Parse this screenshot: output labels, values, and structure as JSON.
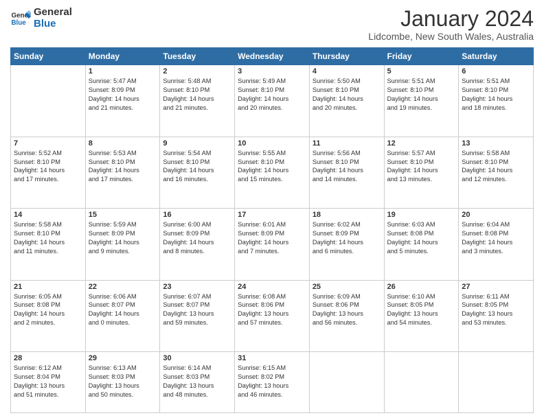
{
  "header": {
    "logo_line1": "General",
    "logo_line2": "Blue",
    "month": "January 2024",
    "location": "Lidcombe, New South Wales, Australia"
  },
  "weekdays": [
    "Sunday",
    "Monday",
    "Tuesday",
    "Wednesday",
    "Thursday",
    "Friday",
    "Saturday"
  ],
  "weeks": [
    [
      {
        "day": "",
        "text": ""
      },
      {
        "day": "1",
        "text": "Sunrise: 5:47 AM\nSunset: 8:09 PM\nDaylight: 14 hours\nand 21 minutes."
      },
      {
        "day": "2",
        "text": "Sunrise: 5:48 AM\nSunset: 8:10 PM\nDaylight: 14 hours\nand 21 minutes."
      },
      {
        "day": "3",
        "text": "Sunrise: 5:49 AM\nSunset: 8:10 PM\nDaylight: 14 hours\nand 20 minutes."
      },
      {
        "day": "4",
        "text": "Sunrise: 5:50 AM\nSunset: 8:10 PM\nDaylight: 14 hours\nand 20 minutes."
      },
      {
        "day": "5",
        "text": "Sunrise: 5:51 AM\nSunset: 8:10 PM\nDaylight: 14 hours\nand 19 minutes."
      },
      {
        "day": "6",
        "text": "Sunrise: 5:51 AM\nSunset: 8:10 PM\nDaylight: 14 hours\nand 18 minutes."
      }
    ],
    [
      {
        "day": "7",
        "text": "Sunrise: 5:52 AM\nSunset: 8:10 PM\nDaylight: 14 hours\nand 17 minutes."
      },
      {
        "day": "8",
        "text": "Sunrise: 5:53 AM\nSunset: 8:10 PM\nDaylight: 14 hours\nand 17 minutes."
      },
      {
        "day": "9",
        "text": "Sunrise: 5:54 AM\nSunset: 8:10 PM\nDaylight: 14 hours\nand 16 minutes."
      },
      {
        "day": "10",
        "text": "Sunrise: 5:55 AM\nSunset: 8:10 PM\nDaylight: 14 hours\nand 15 minutes."
      },
      {
        "day": "11",
        "text": "Sunrise: 5:56 AM\nSunset: 8:10 PM\nDaylight: 14 hours\nand 14 minutes."
      },
      {
        "day": "12",
        "text": "Sunrise: 5:57 AM\nSunset: 8:10 PM\nDaylight: 14 hours\nand 13 minutes."
      },
      {
        "day": "13",
        "text": "Sunrise: 5:58 AM\nSunset: 8:10 PM\nDaylight: 14 hours\nand 12 minutes."
      }
    ],
    [
      {
        "day": "14",
        "text": "Sunrise: 5:58 AM\nSunset: 8:10 PM\nDaylight: 14 hours\nand 11 minutes."
      },
      {
        "day": "15",
        "text": "Sunrise: 5:59 AM\nSunset: 8:09 PM\nDaylight: 14 hours\nand 9 minutes."
      },
      {
        "day": "16",
        "text": "Sunrise: 6:00 AM\nSunset: 8:09 PM\nDaylight: 14 hours\nand 8 minutes."
      },
      {
        "day": "17",
        "text": "Sunrise: 6:01 AM\nSunset: 8:09 PM\nDaylight: 14 hours\nand 7 minutes."
      },
      {
        "day": "18",
        "text": "Sunrise: 6:02 AM\nSunset: 8:09 PM\nDaylight: 14 hours\nand 6 minutes."
      },
      {
        "day": "19",
        "text": "Sunrise: 6:03 AM\nSunset: 8:08 PM\nDaylight: 14 hours\nand 5 minutes."
      },
      {
        "day": "20",
        "text": "Sunrise: 6:04 AM\nSunset: 8:08 PM\nDaylight: 14 hours\nand 3 minutes."
      }
    ],
    [
      {
        "day": "21",
        "text": "Sunrise: 6:05 AM\nSunset: 8:08 PM\nDaylight: 14 hours\nand 2 minutes."
      },
      {
        "day": "22",
        "text": "Sunrise: 6:06 AM\nSunset: 8:07 PM\nDaylight: 14 hours\nand 0 minutes."
      },
      {
        "day": "23",
        "text": "Sunrise: 6:07 AM\nSunset: 8:07 PM\nDaylight: 13 hours\nand 59 minutes."
      },
      {
        "day": "24",
        "text": "Sunrise: 6:08 AM\nSunset: 8:06 PM\nDaylight: 13 hours\nand 57 minutes."
      },
      {
        "day": "25",
        "text": "Sunrise: 6:09 AM\nSunset: 8:06 PM\nDaylight: 13 hours\nand 56 minutes."
      },
      {
        "day": "26",
        "text": "Sunrise: 6:10 AM\nSunset: 8:05 PM\nDaylight: 13 hours\nand 54 minutes."
      },
      {
        "day": "27",
        "text": "Sunrise: 6:11 AM\nSunset: 8:05 PM\nDaylight: 13 hours\nand 53 minutes."
      }
    ],
    [
      {
        "day": "28",
        "text": "Sunrise: 6:12 AM\nSunset: 8:04 PM\nDaylight: 13 hours\nand 51 minutes."
      },
      {
        "day": "29",
        "text": "Sunrise: 6:13 AM\nSunset: 8:03 PM\nDaylight: 13 hours\nand 50 minutes."
      },
      {
        "day": "30",
        "text": "Sunrise: 6:14 AM\nSunset: 8:03 PM\nDaylight: 13 hours\nand 48 minutes."
      },
      {
        "day": "31",
        "text": "Sunrise: 6:15 AM\nSunset: 8:02 PM\nDaylight: 13 hours\nand 46 minutes."
      },
      {
        "day": "",
        "text": ""
      },
      {
        "day": "",
        "text": ""
      },
      {
        "day": "",
        "text": ""
      }
    ]
  ]
}
